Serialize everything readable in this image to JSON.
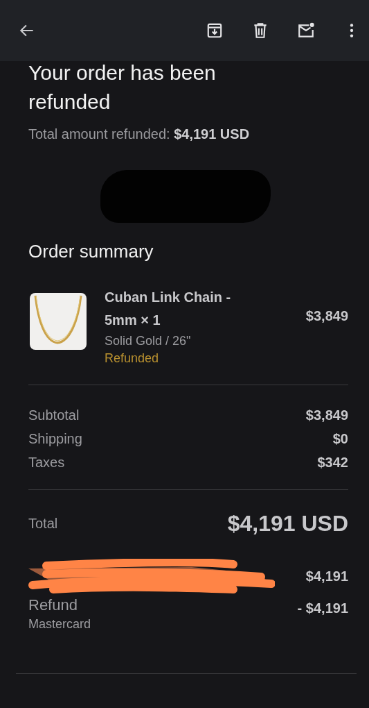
{
  "toolbar": {
    "actions": [
      {
        "kind": "back"
      },
      {
        "kind": "archive"
      },
      {
        "kind": "delete"
      },
      {
        "kind": "unread"
      },
      {
        "kind": "more"
      }
    ]
  },
  "heading": "Your order has been refunded",
  "refund_summary": {
    "label": "Total amount refunded:",
    "amount": "$4,191 USD"
  },
  "redacted_block": true,
  "order_summary": {
    "title": "Order summary",
    "item": {
      "name": "Cuban Link Chain - 5mm × 1",
      "variant": "Solid Gold / 26\"",
      "status": "Refunded",
      "price": "$3,849"
    },
    "lines": [
      {
        "label": "Subtotal",
        "amount": "$3,849"
      },
      {
        "label": "Shipping",
        "amount": "$0"
      },
      {
        "label": "Taxes",
        "amount": "$342"
      }
    ],
    "total": {
      "label": "Total",
      "amount": "$4,191 USD"
    },
    "payments": [
      {
        "redacted": true,
        "amount": "$4,191"
      },
      {
        "redacted": false,
        "label": "Refund",
        "method": "Mastercard",
        "amount": "- $4,191"
      }
    ]
  }
}
